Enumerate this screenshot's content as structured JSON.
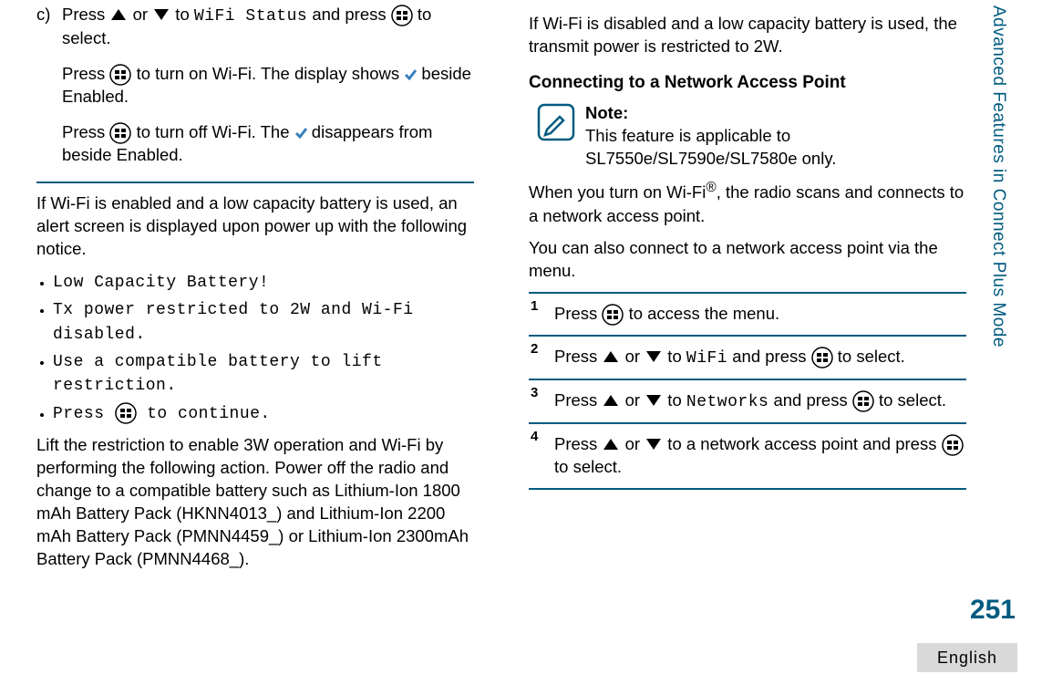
{
  "left": {
    "step_c_label": "c)",
    "c1_a": "Press ",
    "c1_b": " or ",
    "c1_c": " to ",
    "c1_mono": "WiFi Status",
    "c1_d": " and press ",
    "c1_e": " to select.",
    "c2_a": "Press ",
    "c2_b": " to turn on Wi-Fi. The display shows ",
    "c2_c": " beside Enabled.",
    "c3_a": "Press ",
    "c3_b": " to turn off Wi-Fi. The ",
    "c3_c": " disappears from beside Enabled.",
    "p1": "If Wi-Fi is enabled and a low capacity battery is used, an alert screen is displayed upon power up with the following notice.",
    "b1": "Low Capacity Battery!",
    "b2": "Tx power restricted to 2W and Wi-Fi disabled.",
    "b3": "Use a compatible battery to lift restriction.",
    "b4_a": "Press ",
    "b4_b": " to continue.",
    "p2": "Lift the restriction to enable 3W operation and Wi-Fi by performing the following action. Power off the radio and change to a compatible battery such as Lithium-Ion 1800 mAh Battery Pack (HKNN4013_) and Lithium-Ion 2200 mAh Battery Pack (PMNN4459_) or Lithium-Ion 2300mAh Battery Pack (PMNN4468_)."
  },
  "right": {
    "p1": "If Wi-Fi is disabled and a low capacity battery is used, the transmit power is restricted to 2W.",
    "h1": "Connecting to a Network Access Point",
    "note_title": "Note:",
    "note_body": "This feature is applicable to SL7550e/SL7590e/SL7580e only.",
    "p2_a": "When you turn on Wi-Fi",
    "p2_b": ", the radio scans and connects to a network access point.",
    "p3": "You can also connect to a network access point via the menu.",
    "s1_a": "Press ",
    "s1_b": " to access the menu.",
    "s2_a": "Press ",
    "s2_b": " or ",
    "s2_c": " to ",
    "s2_m": "WiFi",
    "s2_d": " and press ",
    "s2_e": " to select.",
    "s3_a": "Press ",
    "s3_b": " or ",
    "s3_c": " to ",
    "s3_m": "Networks",
    "s3_d": " and press ",
    "s3_e": " to select.",
    "s4_a": "Press ",
    "s4_b": " or ",
    "s4_c": " to a network access point and press ",
    "s4_d": " to select."
  },
  "meta": {
    "sidebar": "Advanced Features in Connect Plus Mode",
    "page": "251",
    "lang": "English"
  }
}
